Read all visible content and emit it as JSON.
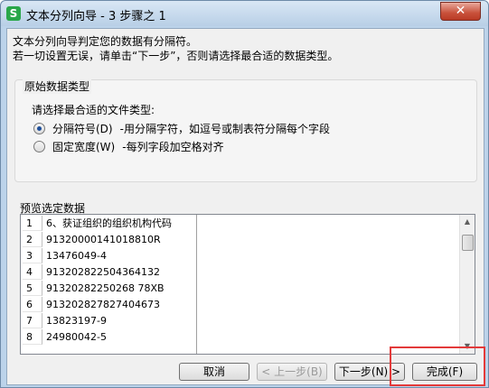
{
  "window": {
    "title": "文本分列向导 - 3 步骤之 1",
    "app_icon_letter": "S",
    "close_symbol": "✕"
  },
  "intro": {
    "line1": "文本分列向导判定您的数据有分隔符。",
    "line2": "若一切设置无误，请单击“下一步”，否则请选择最合适的数据类型。"
  },
  "original_type": {
    "legend": "原始数据类型",
    "prompt": "请选择最合适的文件类型:",
    "options": [
      {
        "label": "分隔符号(D)",
        "desc": "-用分隔字符，如逗号或制表符分隔每个字段",
        "checked": true
      },
      {
        "label": "固定宽度(W)",
        "desc": "-每列字段加空格对齐",
        "checked": false
      }
    ]
  },
  "preview": {
    "label": "预览选定数据",
    "rows": [
      {
        "num": "1",
        "value": "6、获证组织的组织机构代码"
      },
      {
        "num": "2",
        "value": "91320000141018810R"
      },
      {
        "num": "3",
        "value": "13476049-4"
      },
      {
        "num": "4",
        "value": "913202822504364132"
      },
      {
        "num": "5",
        "value": "91320282250268 78XB"
      },
      {
        "num": "6",
        "value": "913202827827404673"
      },
      {
        "num": "7",
        "value": "13823197-9"
      },
      {
        "num": "8",
        "value": "24980042-5"
      }
    ]
  },
  "buttons": {
    "cancel": "取消",
    "back": "< 上一步(B)",
    "next": "下一步(N) >",
    "finish": "完成(F)"
  }
}
